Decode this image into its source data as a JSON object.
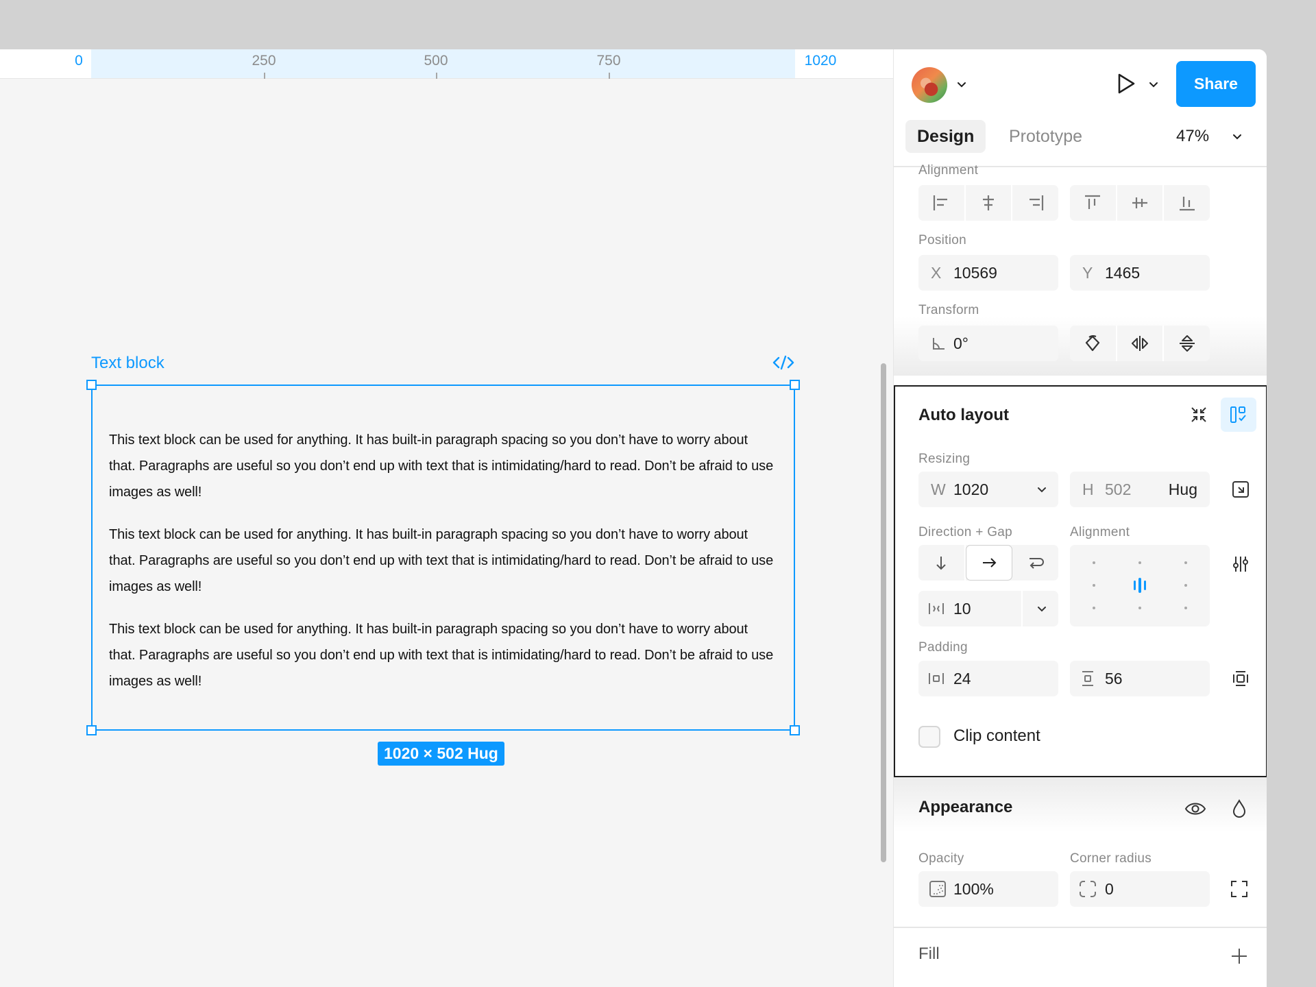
{
  "ruler": {
    "labels": [
      "0",
      "250",
      "500",
      "750",
      "1020"
    ]
  },
  "canvas": {
    "frame_label": "Text block",
    "paragraphs": [
      "This text block can be used for anything. It has built-in paragraph spacing so you don’t have to worry about that. Paragraphs are useful so you don’t end up with text that is intimidating/hard to read. Don’t be afraid to use images as well!",
      "This text block can be used for anything. It has built-in paragraph spacing so you don’t have to worry about that. Paragraphs are useful so you don’t end up with text that is intimidating/hard to read. Don’t be afraid to use images as well!",
      "This text block can be used for anything. It has built-in paragraph spacing so you don’t have to worry about that. Paragraphs are useful so you don’t end up with text that is intimidating/hard to read. Don’t be afraid to use images as well!"
    ],
    "size_badge": "1020 × 502 Hug"
  },
  "header": {
    "share_label": "Share",
    "tabs": {
      "design": "Design",
      "prototype": "Prototype"
    },
    "zoom": "47%"
  },
  "alignment": {
    "label": "Alignment"
  },
  "position": {
    "label": "Position",
    "x_prefix": "X",
    "x_value": "10569",
    "y_prefix": "Y",
    "y_value": "1465"
  },
  "transform": {
    "label": "Transform",
    "rotation": "0°"
  },
  "auto_layout": {
    "title": "Auto layout",
    "resizing_label": "Resizing",
    "w_prefix": "W",
    "w_value": "1020",
    "h_prefix": "H",
    "h_value": "502",
    "h_mode": "Hug",
    "direction_gap_label": "Direction + Gap",
    "alignment_label": "Alignment",
    "gap_value": "10",
    "padding_label": "Padding",
    "padding_horizontal": "24",
    "padding_vertical": "56",
    "clip_content_label": "Clip content",
    "clip_content_checked": false
  },
  "appearance": {
    "title": "Appearance",
    "opacity_label": "Opacity",
    "opacity_value": "100%",
    "corner_radius_label": "Corner radius",
    "corner_radius_value": "0"
  },
  "fill": {
    "title": "Fill"
  },
  "colors": {
    "accent": "#0d99ff",
    "canvas": "#f5f5f5",
    "panel": "#ffffff"
  }
}
